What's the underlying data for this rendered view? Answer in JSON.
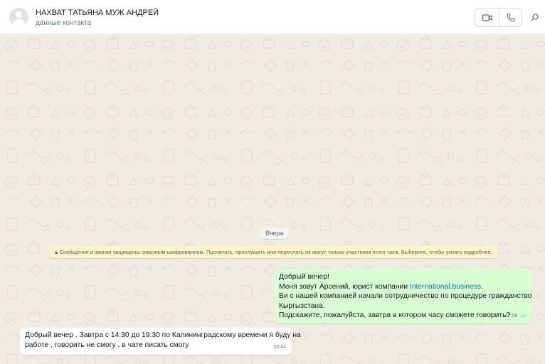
{
  "header": {
    "contact_name": "НАХВАТ ТАТЬЯНА МУЖ АНДРЕЙ",
    "contact_subtitle": "данные контакта",
    "video_call_icon": "video-camera-icon",
    "voice_call_icon": "phone-icon",
    "search_icon": "search-icon"
  },
  "chat": {
    "date_divider": "Вчера",
    "encryption_notice": "Сообщения и звонки защищены сквозным шифрованием. Прочитать, прослушать или переслать их могут только участники этого чата. Выберите, чтобы узнать подробнее.",
    "messages": [
      {
        "direction": "outgoing",
        "lines": [
          "Добрый вечер!",
          "Меня зовут Арсений, юрист компании",
          "Ви с нашей компанией начали сотрудничество по процедуре гражданство",
          "Кыргызстана.",
          "Подскажите, пожалуйста, завтра в котором часу сможете говорить?"
        ],
        "link_text": "International.business.",
        "time": "17:58",
        "status": "read"
      },
      {
        "direction": "incoming",
        "lines": [
          "Добрый вечер . Завтра с 14:30 до 19:30 по Калининградскому времени я буду на",
          "работе , говорить не смогу , в чате писать смогу"
        ],
        "time": "20:44"
      }
    ]
  },
  "colors": {
    "chat_background": "#efeae2",
    "outgoing_bubble": "#d9fdd3",
    "incoming_bubble": "#ffffff",
    "notice_background": "#fdf3c9",
    "link": "#027eb5",
    "read_ticks": "#53bdeb"
  }
}
